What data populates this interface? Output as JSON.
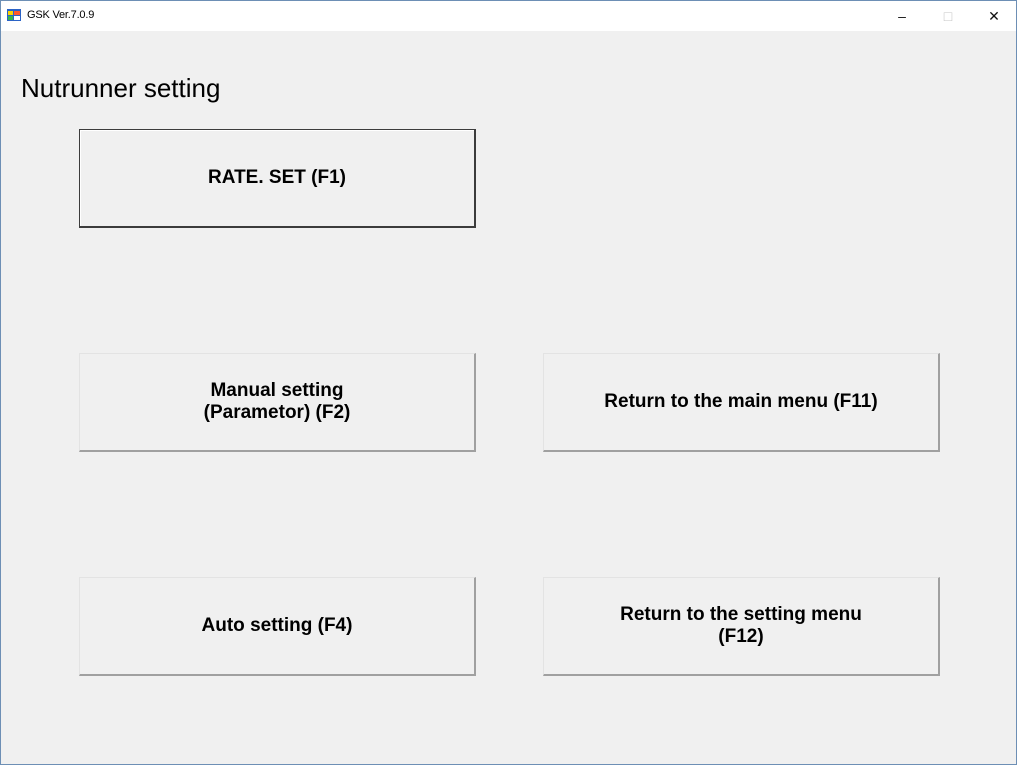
{
  "window": {
    "title": "GSK Ver.7.0.9",
    "controls": {
      "minimize": "–",
      "maximize": "□",
      "close": "✕"
    }
  },
  "page": {
    "heading": "Nutrunner setting"
  },
  "buttons": {
    "rate_set": {
      "line1": "RATE. SET (F1)"
    },
    "manual_setting": {
      "line1": "Manual setting",
      "line2": "(Parametor) (F2)"
    },
    "return_main": {
      "line1": "Return to the main menu (F11)"
    },
    "auto_setting": {
      "line1": "Auto setting (F4)"
    },
    "return_setting": {
      "line1": "Return to the setting menu",
      "line2": "(F12)"
    }
  },
  "colors": {
    "window_bg": "#f0f0f0",
    "titlebar_bg": "#ffffff",
    "window_border": "#6d8fb5"
  },
  "icons": {
    "app": "app-window-icon"
  }
}
